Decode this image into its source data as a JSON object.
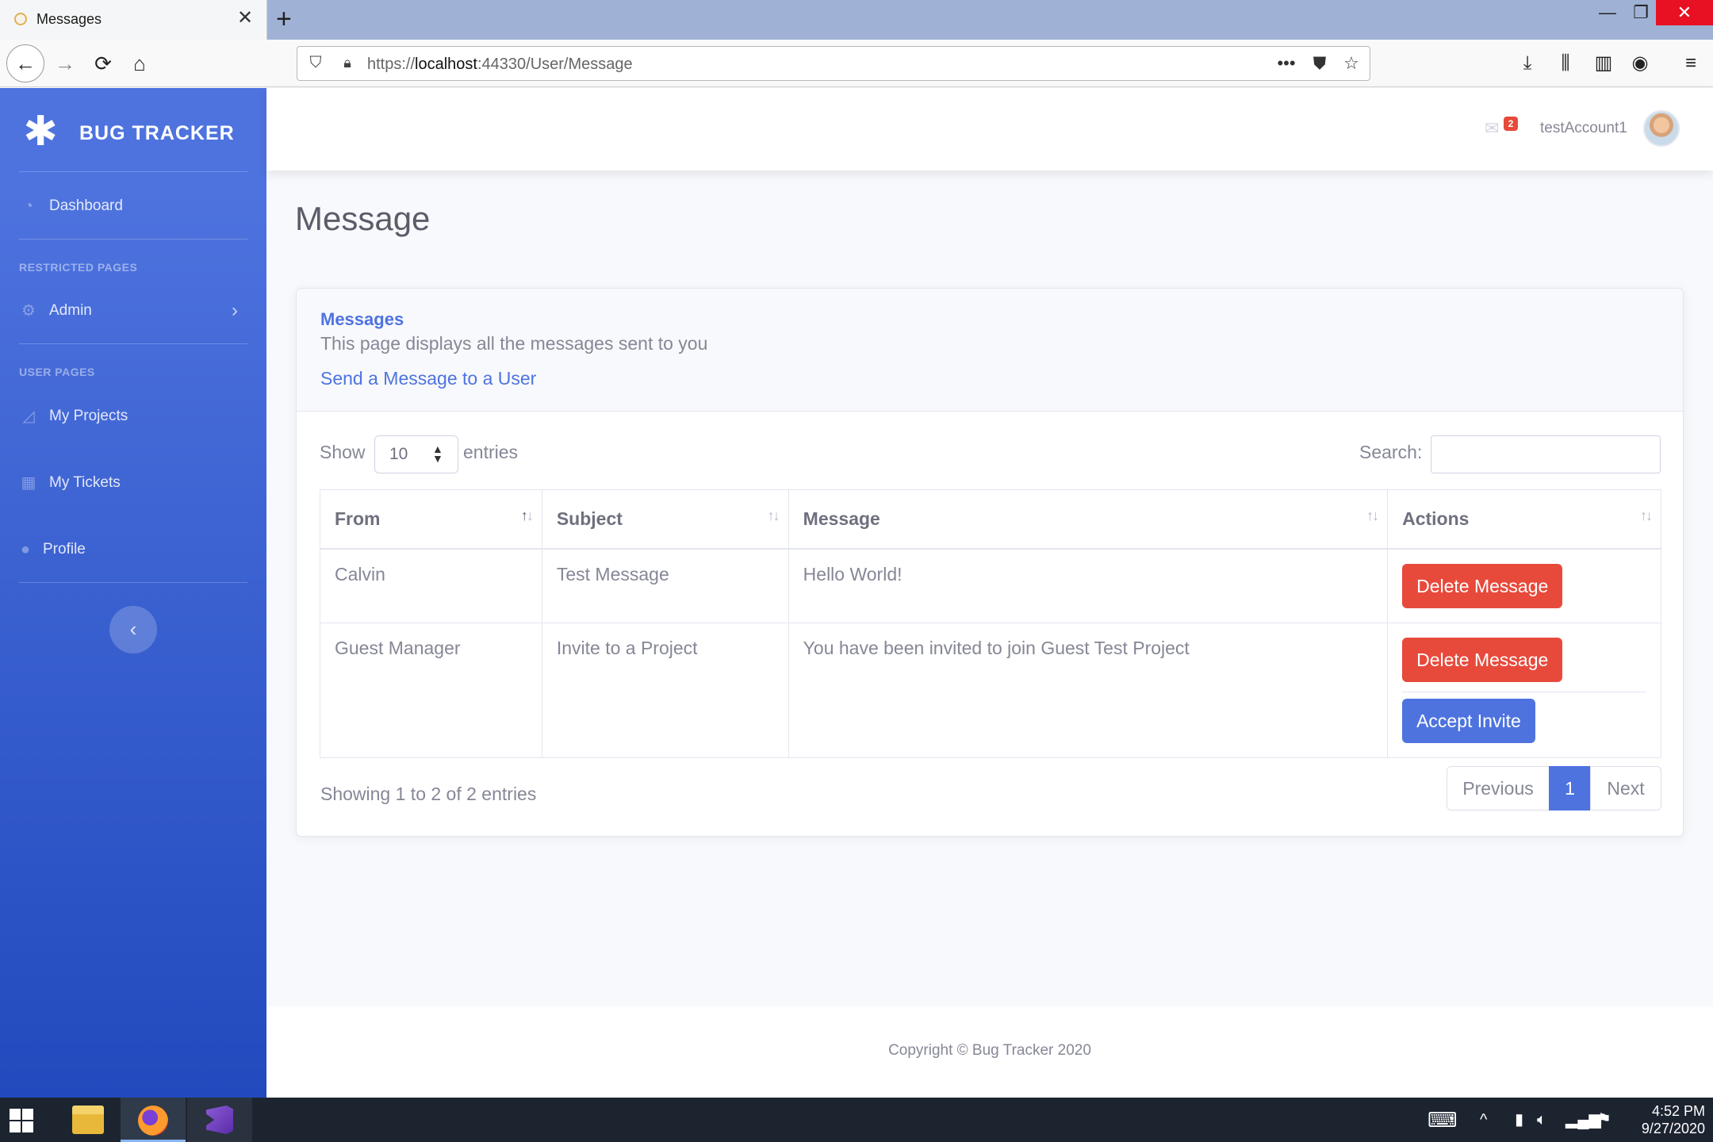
{
  "browser": {
    "tab_title": "Messages",
    "tab_close": "✕",
    "new_tab": "+",
    "url_prefix": "https://",
    "url_host": "localhost",
    "url_rest": ":44330/User/Message",
    "window_controls": {
      "minimize": "—",
      "maximize": "❐",
      "close": "✕"
    },
    "icons": [
      "back-icon",
      "forward-icon",
      "reload-icon",
      "home-icon",
      "shield-icon",
      "lock-icon",
      "more-icon",
      "pocket-icon",
      "bookmark-star-icon",
      "download-icon",
      "library-icon",
      "sidebar-icon",
      "account-icon",
      "menu-icon"
    ]
  },
  "sidebar": {
    "brand": "BUG TRACKER",
    "dashboard": "Dashboard",
    "heading_restricted": "RESTRICTED PAGES",
    "admin": "Admin",
    "heading_user": "USER PAGES",
    "my_projects": "My Projects",
    "my_tickets": "My Tickets",
    "profile": "Profile",
    "toggle": "‹"
  },
  "topbar": {
    "message_count": "2",
    "username": "testAccount1"
  },
  "page": {
    "title": "Message"
  },
  "card": {
    "title": "Messages",
    "subtitle": "This page displays all the messages sent to you",
    "link": "Send a Message to a User",
    "show": "Show",
    "length_value": "10",
    "entries": "entries",
    "search_label": "Search:",
    "search_value": "",
    "columns": [
      "From",
      "Subject",
      "Message",
      "Actions"
    ],
    "rows": [
      {
        "from": "Calvin",
        "subject": "Test Message",
        "message": "Hello World!",
        "actions": [
          "Delete Message"
        ]
      },
      {
        "from": "Guest Manager",
        "subject": "Invite to a Project",
        "message": "You have been invited to join Guest Test Project",
        "actions": [
          "Delete Message",
          "Accept Invite"
        ]
      }
    ],
    "info": "Showing 1 to 2 of 2 entries",
    "pager": {
      "previous": "Previous",
      "current": "1",
      "next": "Next"
    }
  },
  "footer": {
    "text": "Copyright © Bug Tracker 2020"
  },
  "taskbar": {
    "time": "4:52 PM",
    "date": "9/27/2020"
  },
  "colors": {
    "primary": "#4e73df",
    "danger": "#e74a3b",
    "sidebar_gradient_top": "#4e73df",
    "sidebar_gradient_bottom": "#224abe"
  }
}
